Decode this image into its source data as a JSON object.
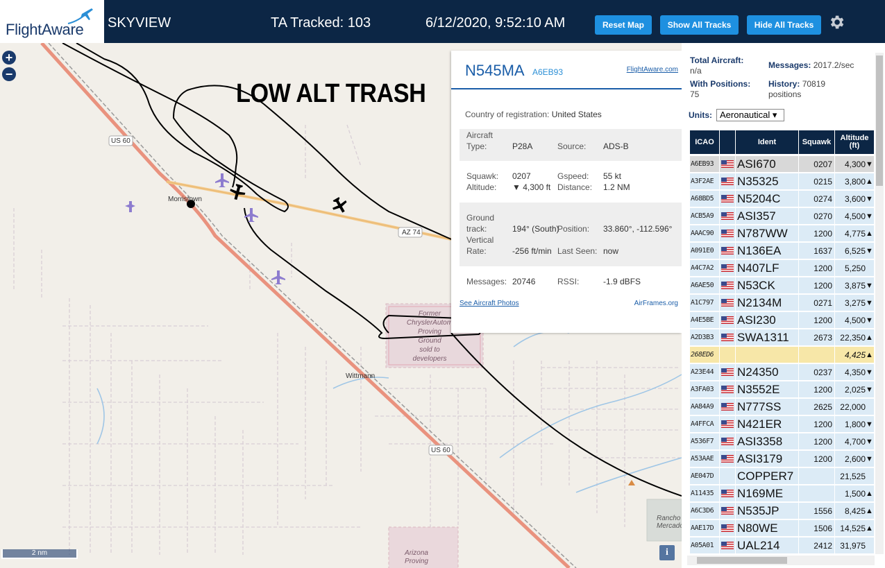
{
  "header": {
    "logo_text": "FlightAware",
    "app_name": "SKYVIEW",
    "tracked_label": "TA Tracked: 103",
    "datetime": "6/12/2020, 9:52:10 AM",
    "buttons": {
      "reset": "Reset Map",
      "show": "Show All Tracks",
      "hide": "Hide All Tracks"
    },
    "icons": {
      "settings": "gear-icon"
    },
    "colors": {
      "bar": "#0c2645",
      "button": "#1e90e0"
    }
  },
  "map": {
    "zoom_in": "+",
    "zoom_out": "−",
    "overlay_title": "LOW ALT TRASH",
    "scale": "2 nm",
    "info": "i",
    "labels": {
      "us60_a": "US 60",
      "us60_b": "US 60",
      "az74": "AZ 74",
      "morristown": "Morristown",
      "wittmann": "Wittmann",
      "former_plant": [
        "Former",
        "ChryslerAutom",
        "Proving",
        "Ground",
        "sold to",
        "developers"
      ],
      "arizona_proving": [
        "Arizona",
        "Proving"
      ],
      "rancho": [
        "Rancho",
        "Mercado"
      ]
    }
  },
  "popup": {
    "registration": "N545MA",
    "hex": "A6EB93",
    "fa_link": "FlightAware.com",
    "country_label": "Country of registration:",
    "country_value": "United States",
    "aircraft_label": "Aircraft",
    "type_label": "Type:",
    "type_value": "P28A",
    "source_label": "Source:",
    "source_value": "ADS-B",
    "squawk_label": "Squawk:",
    "squawk_value": "0207",
    "gspeed_label": "Gspeed:",
    "gspeed_value": "55 kt",
    "altitude_label": "Altitude:",
    "altitude_value": "▼ 4,300 ft",
    "distance_label": "Distance:",
    "distance_value": "1.2 NM",
    "ground_label": "Ground",
    "track_label": "track:",
    "track_value": "194° (South)",
    "position_label": "Position:",
    "position_value": "33.860°, -112.596°",
    "vertical_label": "Vertical",
    "rate_label": "Rate:",
    "rate_value": "-256 ft/min",
    "lastseen_label": "Last Seen:",
    "lastseen_value": "now",
    "messages_label": "Messages:",
    "messages_value": "20746",
    "rssi_label": "RSSI:",
    "rssi_value": "-1.9 dBFS",
    "photos_link": "See Aircraft Photos",
    "airframes_link": "AirFrames.org"
  },
  "side": {
    "total_label": "Total Aircraft:",
    "total_value": "n/a",
    "messages_label": "Messages:",
    "messages_value": "2017.2/sec",
    "withpos_label": "With Positions:",
    "withpos_value": "75",
    "history_label": "History:",
    "history_value": "70819",
    "history_unit": "positions",
    "units_label": "Units:",
    "units_value": "Aeronautical ▾",
    "columns": [
      "ICAO",
      "",
      "Ident",
      "Squawk",
      "Altitude (ft)"
    ],
    "rows": [
      {
        "icao": "A6EB93",
        "flag": true,
        "ident": "ASI670",
        "squawk": "0207",
        "alt": "4,300",
        "arrow": "▼",
        "state": "sel"
      },
      {
        "icao": "A3F2AE",
        "flag": true,
        "ident": "N35325",
        "squawk": "0215",
        "alt": "3,800",
        "arrow": "▲",
        "state": ""
      },
      {
        "icao": "A68BD5",
        "flag": true,
        "ident": "N5204C",
        "squawk": "0274",
        "alt": "3,600",
        "arrow": "▼",
        "state": ""
      },
      {
        "icao": "ACB5A9",
        "flag": true,
        "ident": "ASI357",
        "squawk": "0270",
        "alt": "4,500",
        "arrow": "▼",
        "state": ""
      },
      {
        "icao": "AAAC90",
        "flag": true,
        "ident": "N787WW",
        "squawk": "1200",
        "alt": "4,775",
        "arrow": "▲",
        "state": ""
      },
      {
        "icao": "A091E0",
        "flag": true,
        "ident": "N136EA",
        "squawk": "1637",
        "alt": "6,525",
        "arrow": "▼",
        "state": ""
      },
      {
        "icao": "A4C7A2",
        "flag": true,
        "ident": "N407LF",
        "squawk": "1200",
        "alt": "5,250",
        "arrow": "",
        "state": ""
      },
      {
        "icao": "A6AE50",
        "flag": true,
        "ident": "N53CK",
        "squawk": "1200",
        "alt": "3,875",
        "arrow": "▼",
        "state": ""
      },
      {
        "icao": "A1C797",
        "flag": true,
        "ident": "N2134M",
        "squawk": "0271",
        "alt": "3,275",
        "arrow": "▼",
        "state": ""
      },
      {
        "icao": "A4E5BE",
        "flag": true,
        "ident": "ASI230",
        "squawk": "1200",
        "alt": "4,500",
        "arrow": "▼",
        "state": ""
      },
      {
        "icao": "A2D3B3",
        "flag": true,
        "ident": "SWA1311",
        "squawk": "2673",
        "alt": "22,350",
        "arrow": "▲",
        "state": ""
      },
      {
        "icao": "268ED6",
        "flag": false,
        "ident": "",
        "squawk": "",
        "alt": "4,425",
        "arrow": "▲",
        "state": "hl"
      },
      {
        "icao": "A23E44",
        "flag": true,
        "ident": "N24350",
        "squawk": "0237",
        "alt": "4,350",
        "arrow": "▼",
        "state": ""
      },
      {
        "icao": "A3FA03",
        "flag": true,
        "ident": "N3552E",
        "squawk": "1200",
        "alt": "2,025",
        "arrow": "▼",
        "state": ""
      },
      {
        "icao": "AA84A9",
        "flag": true,
        "ident": "N777SS",
        "squawk": "2625",
        "alt": "22,000",
        "arrow": "",
        "state": ""
      },
      {
        "icao": "A4FFCA",
        "flag": true,
        "ident": "N421ER",
        "squawk": "1200",
        "alt": "1,800",
        "arrow": "▼",
        "state": ""
      },
      {
        "icao": "A536F7",
        "flag": true,
        "ident": "ASI3358",
        "squawk": "1200",
        "alt": "4,700",
        "arrow": "▼",
        "state": ""
      },
      {
        "icao": "A53AAE",
        "flag": true,
        "ident": "ASI3179",
        "squawk": "1200",
        "alt": "2,600",
        "arrow": "▼",
        "state": ""
      },
      {
        "icao": "AE047D",
        "flag": false,
        "ident": "COPPER7",
        "squawk": "",
        "alt": "21,525",
        "arrow": "",
        "state": ""
      },
      {
        "icao": "A11435",
        "flag": true,
        "ident": "N169ME",
        "squawk": "",
        "alt": "1,500",
        "arrow": "▲",
        "state": ""
      },
      {
        "icao": "A6C3D6",
        "flag": true,
        "ident": "N535JP",
        "squawk": "1556",
        "alt": "8,425",
        "arrow": "▲",
        "state": ""
      },
      {
        "icao": "AAE17D",
        "flag": true,
        "ident": "N80WE",
        "squawk": "1506",
        "alt": "14,525",
        "arrow": "▲",
        "state": ""
      },
      {
        "icao": "A05A01",
        "flag": true,
        "ident": "UAL214",
        "squawk": "2412",
        "alt": "31,975",
        "arrow": "",
        "state": ""
      }
    ]
  }
}
